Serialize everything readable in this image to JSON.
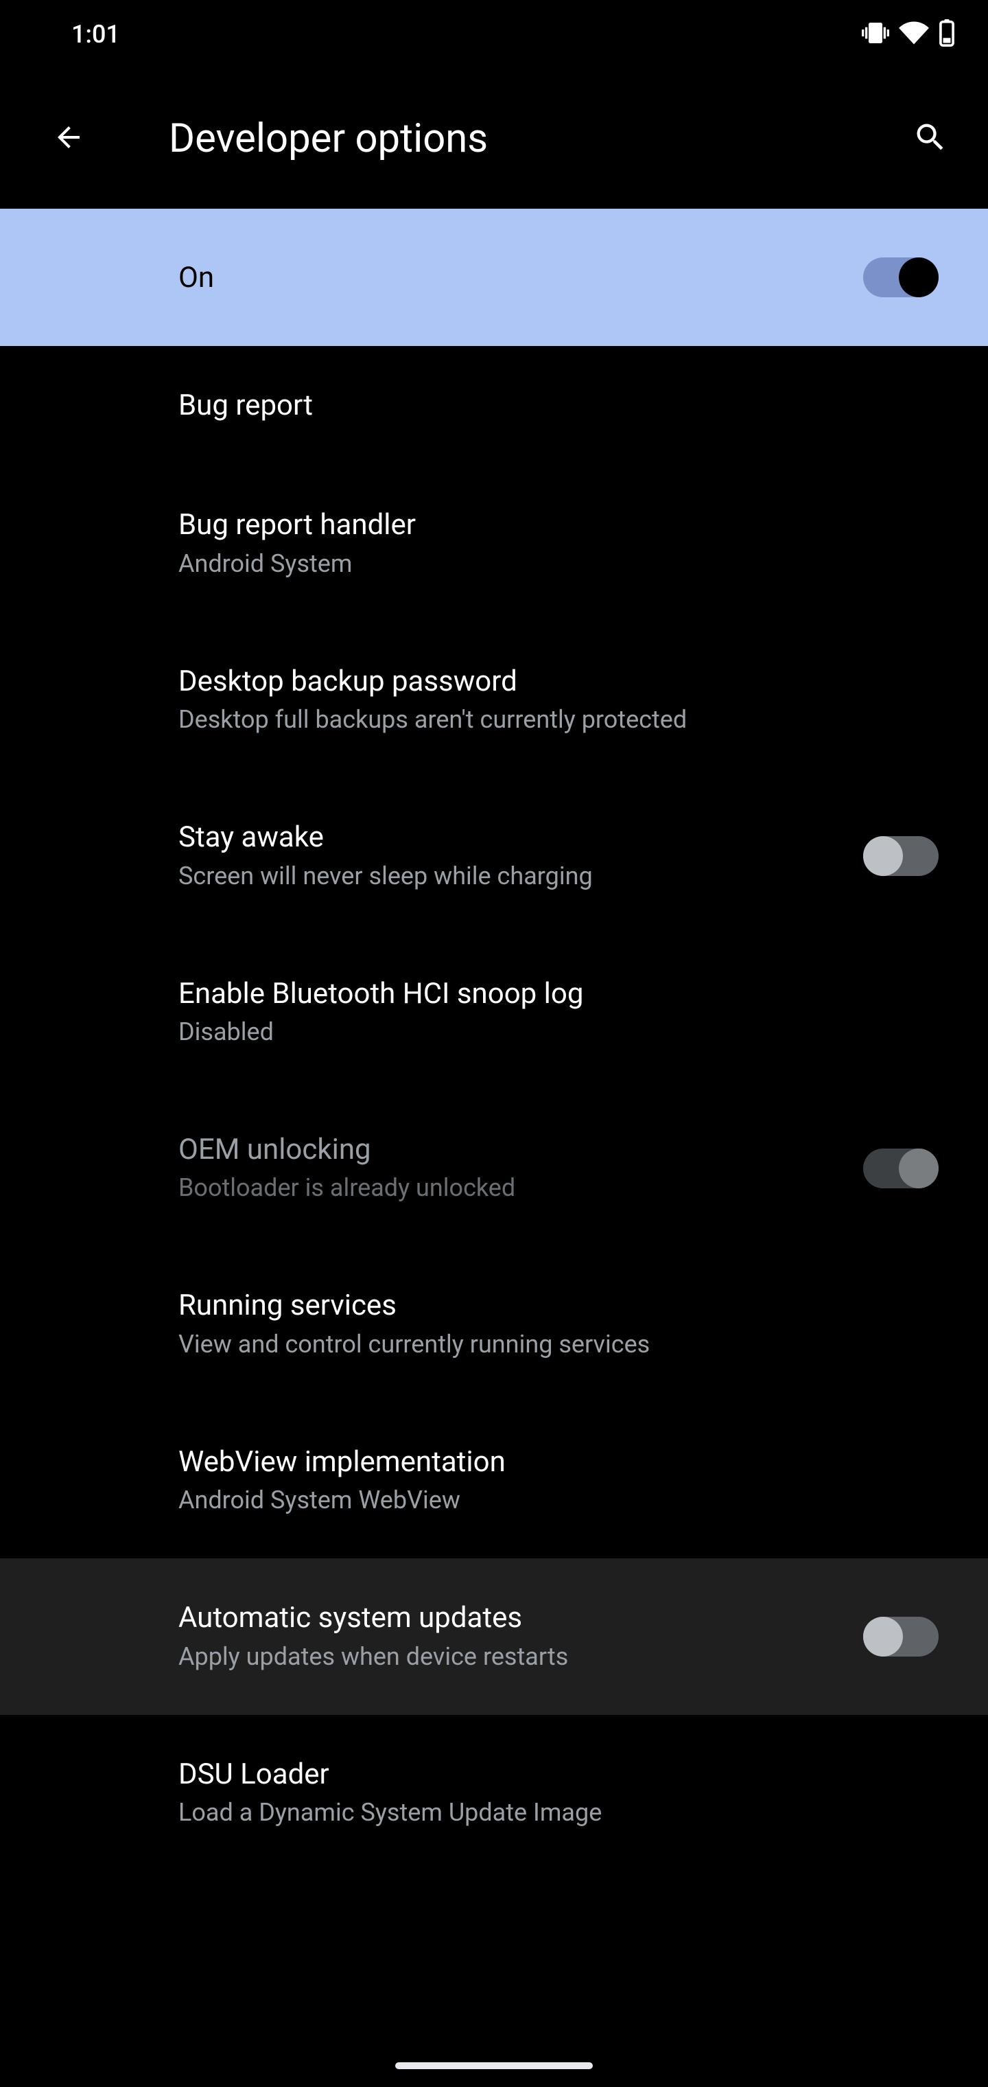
{
  "status": {
    "time": "1:01"
  },
  "header": {
    "title": "Developer options"
  },
  "master": {
    "label": "On",
    "enabled": true
  },
  "items": [
    {
      "title": "Bug report"
    },
    {
      "title": "Bug report handler",
      "sub": "Android System"
    },
    {
      "title": "Desktop backup password",
      "sub": "Desktop full backups aren't currently protected"
    },
    {
      "title": "Stay awake",
      "sub": "Screen will never sleep while charging",
      "toggle": false
    },
    {
      "title": "Enable Bluetooth HCI snoop log",
      "sub": "Disabled"
    },
    {
      "title": "OEM unlocking",
      "sub": "Bootloader is already unlocked",
      "toggle": true,
      "disabled": true
    },
    {
      "title": "Running services",
      "sub": "View and control currently running services"
    },
    {
      "title": "WebView implementation",
      "sub": "Android System WebView"
    },
    {
      "title": "Automatic system updates",
      "sub": "Apply updates when device restarts",
      "toggle": false,
      "highlight": true
    },
    {
      "title": "DSU Loader",
      "sub": "Load a Dynamic System Update Image"
    }
  ]
}
